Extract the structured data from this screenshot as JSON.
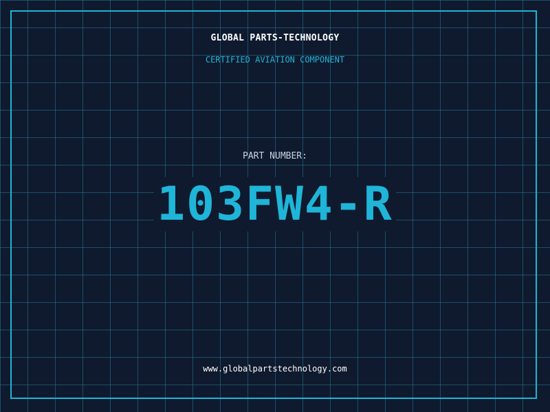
{
  "header": {
    "company_name": "GLOBAL PARTS-TECHNOLOGY",
    "tagline": "CERTIFIED AVIATION COMPONENT"
  },
  "part": {
    "label": "PART NUMBER:",
    "number": "103FW4-R"
  },
  "footer": {
    "website": "www.globalpartstechnology.com"
  },
  "colors": {
    "background": "#0f1a2e",
    "grid": "#287896",
    "accent": "#1fb5d8",
    "text": "#ffffff",
    "label": "#c8d2e2"
  }
}
